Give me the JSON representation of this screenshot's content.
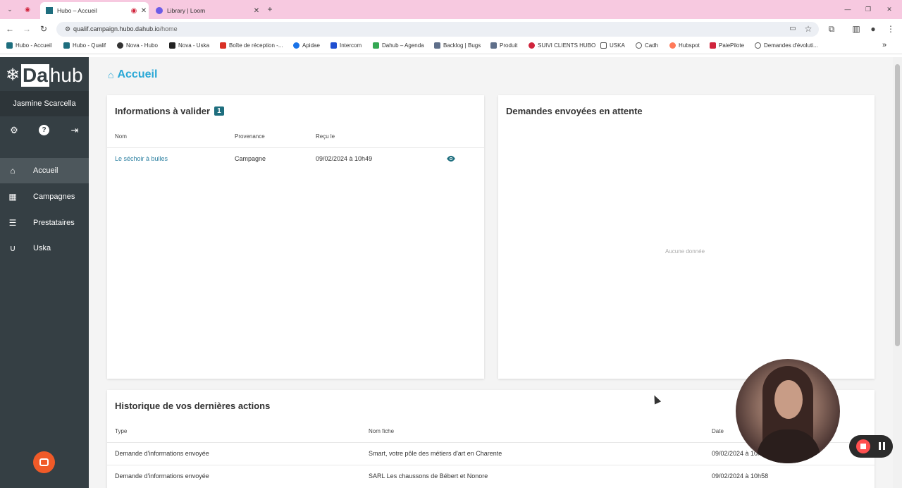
{
  "browser": {
    "tabs": [
      {
        "title": "Hubo – Accueil",
        "active": true
      },
      {
        "title": "Library | Loom",
        "active": false
      }
    ],
    "new_tab": "+",
    "window_controls": {
      "minimize": "—",
      "restore": "❐",
      "close": "✕"
    },
    "url_host": "qualif.campaign.hubo.dahub.io",
    "url_path": "/home",
    "bookmarks": [
      "Hubo - Accueil",
      "Hubo - Qualif",
      "Nova - Hubo",
      "Nova - Uska",
      "Boîte de réception -...",
      "Apidae",
      "Intercom",
      "Dahub – Agenda",
      "Backlog | Bugs",
      "Produit",
      "SUIVI CLIENTS HUBO",
      "USKA",
      "Cadh",
      "Hubspot",
      "PaiePilote",
      "Demandes d'évoluti..."
    ],
    "bookmarks_more": "»"
  },
  "sidebar": {
    "logo_da": "Da",
    "logo_hub": "hub",
    "user_name": "Jasmine Scarcella",
    "items": [
      {
        "label": "Accueil",
        "icon": "home-icon",
        "active": true
      },
      {
        "label": "Campagnes",
        "icon": "dashboard-icon",
        "active": false
      },
      {
        "label": "Prestataires",
        "icon": "list-icon",
        "active": false
      },
      {
        "label": "Uska",
        "icon": "magnet-icon",
        "active": false
      }
    ]
  },
  "page": {
    "title": "Accueil"
  },
  "validate_card": {
    "title": "Informations à valider",
    "badge": "1",
    "columns": [
      "Nom",
      "Provenance",
      "Reçu le"
    ],
    "rows": [
      {
        "nom": "Le séchoir à bulles",
        "provenance": "Campagne",
        "recu": "09/02/2024 à 10h49"
      }
    ]
  },
  "pending_card": {
    "title": "Demandes envoyées en attente",
    "empty": "Aucune donnée"
  },
  "history_card": {
    "title": "Historique de vos dernières actions",
    "columns": [
      "Type",
      "Nom fiche",
      "Date"
    ],
    "rows": [
      {
        "type": "Demande d'informations envoyée",
        "fiche": "Smart, votre pôle des métiers d'art en Charente",
        "date": "09/02/2024 à 10h58"
      },
      {
        "type": "Demande d'informations envoyée",
        "fiche": "SARL Les chaussons de Bébert et Nonore",
        "date": "09/02/2024 à 10h58"
      }
    ]
  },
  "colors": {
    "sidebar": "#353f44",
    "accent": "#2aa8d6",
    "badge": "#1e6e7e",
    "tabbar": "#f7c9e0"
  }
}
